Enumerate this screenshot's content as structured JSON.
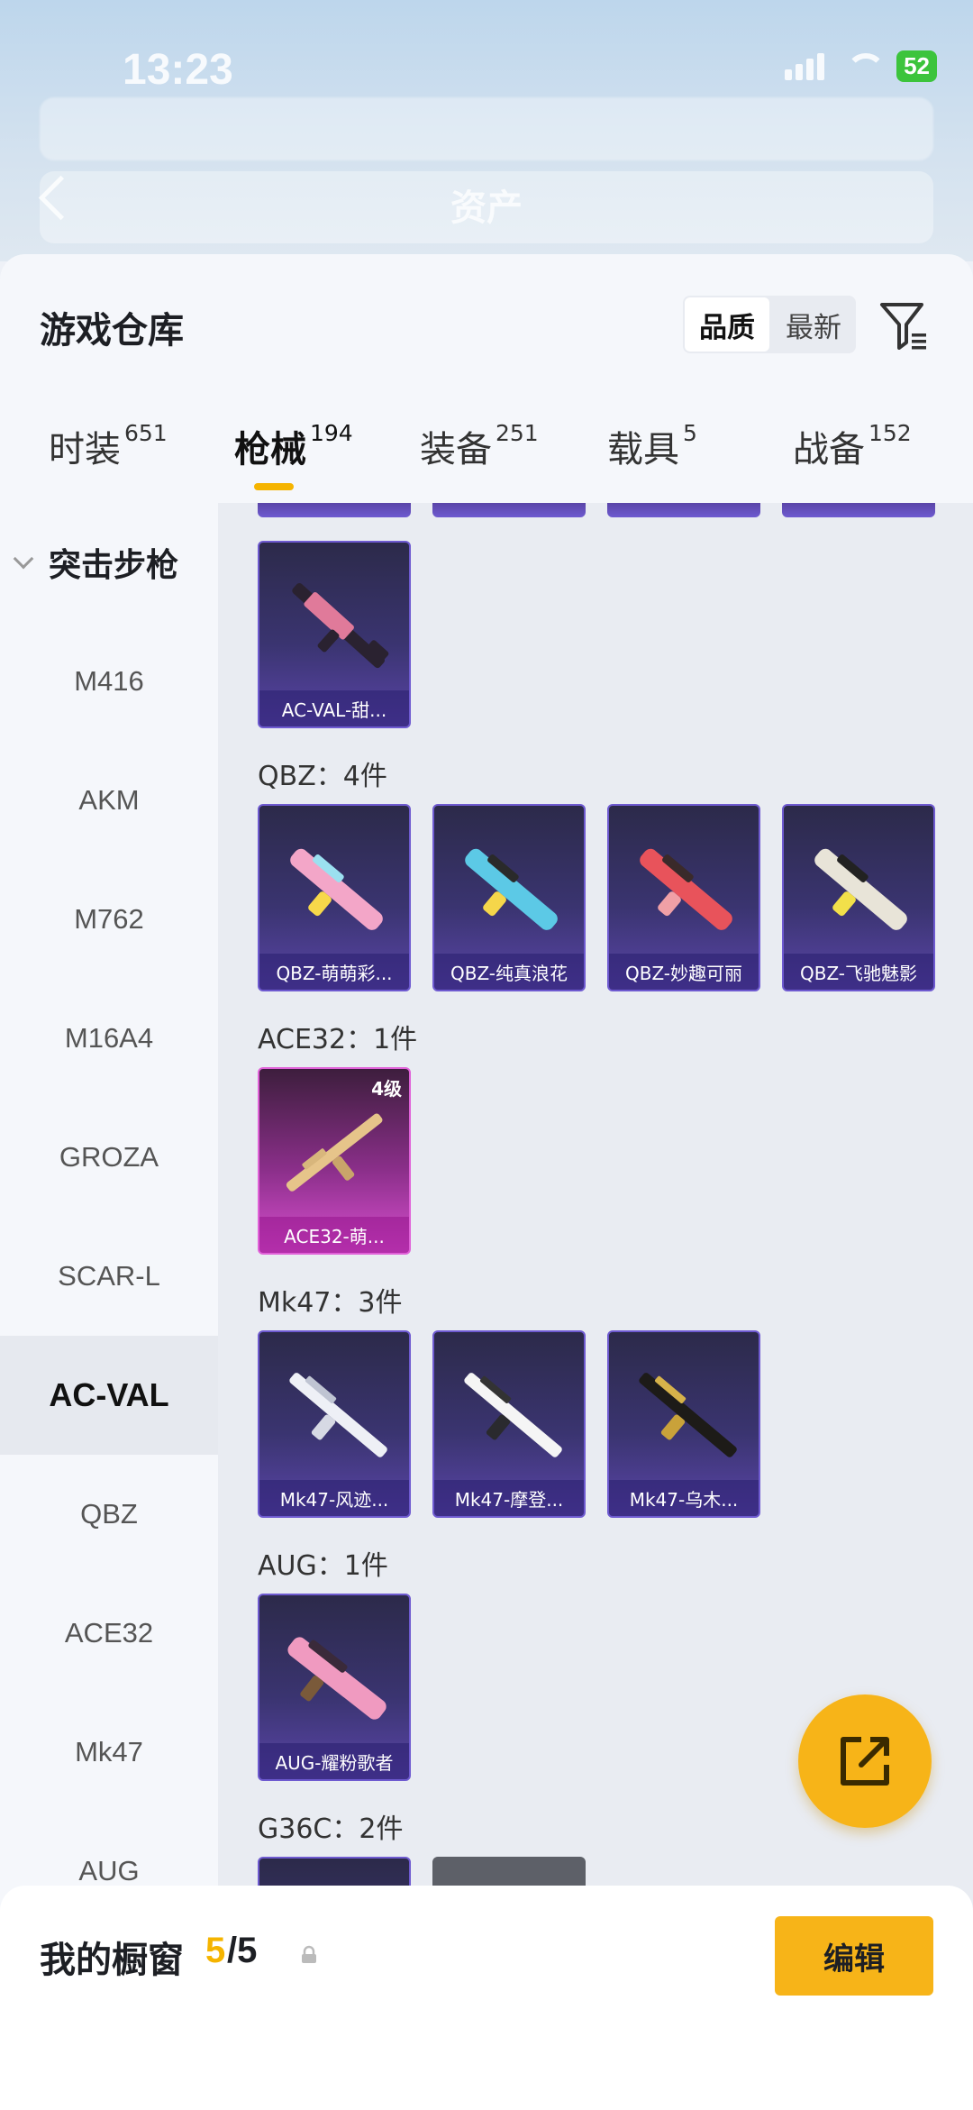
{
  "status_bar": {
    "time": "13:23",
    "battery": "52"
  },
  "backdrop": {
    "title": "资产"
  },
  "panel": {
    "title": "游戏仓库",
    "sort": {
      "quality": "品质",
      "newest": "最新"
    }
  },
  "tabs": [
    {
      "label": "时装",
      "count": "651"
    },
    {
      "label": "枪械",
      "count": "194"
    },
    {
      "label": "装备",
      "count": "251"
    },
    {
      "label": "载具",
      "count": "5"
    },
    {
      "label": "战备",
      "count": "152"
    }
  ],
  "categories": {
    "group": "突击步枪",
    "items": [
      "M416",
      "AKM",
      "M762",
      "M16A4",
      "GROZA",
      "SCAR-L",
      "AC-VAL",
      "QBZ",
      "ACE32",
      "Mk47",
      "AUG"
    ],
    "selected": "AC-VAL"
  },
  "sections": {
    "acval": {
      "card": "AC-VAL-甜..."
    },
    "qbz": {
      "title": "QBZ：4件",
      "cards": [
        "QBZ-萌萌彩...",
        "QBZ-纯真浪花",
        "QBZ-妙趣可丽",
        "QBZ-飞驰魅影"
      ]
    },
    "ace32": {
      "title": "ACE32：1件",
      "cards": [
        "ACE32-萌..."
      ],
      "level": "4级"
    },
    "mk47": {
      "title": "Mk47：3件",
      "cards": [
        "Mk47-风迹...",
        "Mk47-摩登...",
        "Mk47-乌木..."
      ]
    },
    "aug": {
      "title": "AUG：1件",
      "cards": [
        "AUG-耀粉歌者"
      ]
    },
    "g36c": {
      "title": "G36C：2件"
    }
  },
  "showcase": {
    "label": "我的橱窗",
    "current": "5",
    "total": "/5",
    "edit": "编辑"
  },
  "icons": {
    "filter": "filter-icon",
    "share": "share-icon",
    "lock": "lock-icon",
    "back": "back-arrow-icon"
  },
  "colors": {
    "accent": "#f7b418",
    "card_purple": "#3a3470",
    "card_pink": "#d94fd0"
  }
}
